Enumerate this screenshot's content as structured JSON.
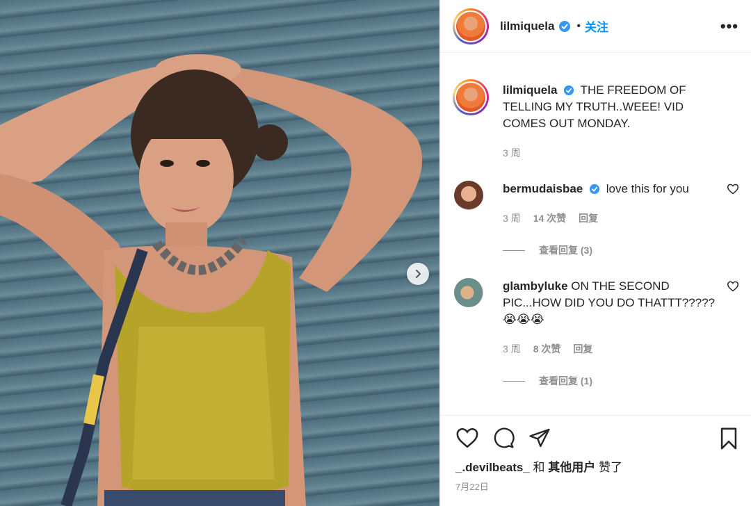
{
  "header": {
    "username": "lilmiquela",
    "separator": "•",
    "follow_label": "关注",
    "more_label": "•••"
  },
  "caption": {
    "username": "lilmiquela",
    "text": "THE FREEDOM OF TELLING MY TRUTH..WEEE! VID COMES OUT MONDAY.",
    "time": "3 周"
  },
  "comments": [
    {
      "username": "bermudaisbae",
      "verified": true,
      "text": "love this for you",
      "time": "3 周",
      "likes": "14 次赞",
      "reply_label": "回复",
      "view_replies": "查看回复 (3)"
    },
    {
      "username": "glambyluke",
      "verified": false,
      "text": "ON THE SECOND PIC...HOW DID YOU DO THATTT????? 😭😭😭",
      "time": "3 周",
      "likes": "8 次赞",
      "reply_label": "回复",
      "view_replies": "查看回复 (1)"
    }
  ],
  "footer": {
    "liked_by_user": "_.devilbeats_",
    "liked_conj": " 和 ",
    "liked_others": "其他用户",
    "liked_suffix": " 赞了",
    "date": "7月22日"
  },
  "icons": [
    "heart-icon",
    "comment-icon",
    "share-icon",
    "bookmark-icon",
    "chevron-right-icon",
    "verified-icon",
    "more-icon"
  ],
  "colors": {
    "accent": "#0095f6",
    "muted": "#8e8e8e",
    "text": "#262626",
    "verified": "#3897f0"
  }
}
